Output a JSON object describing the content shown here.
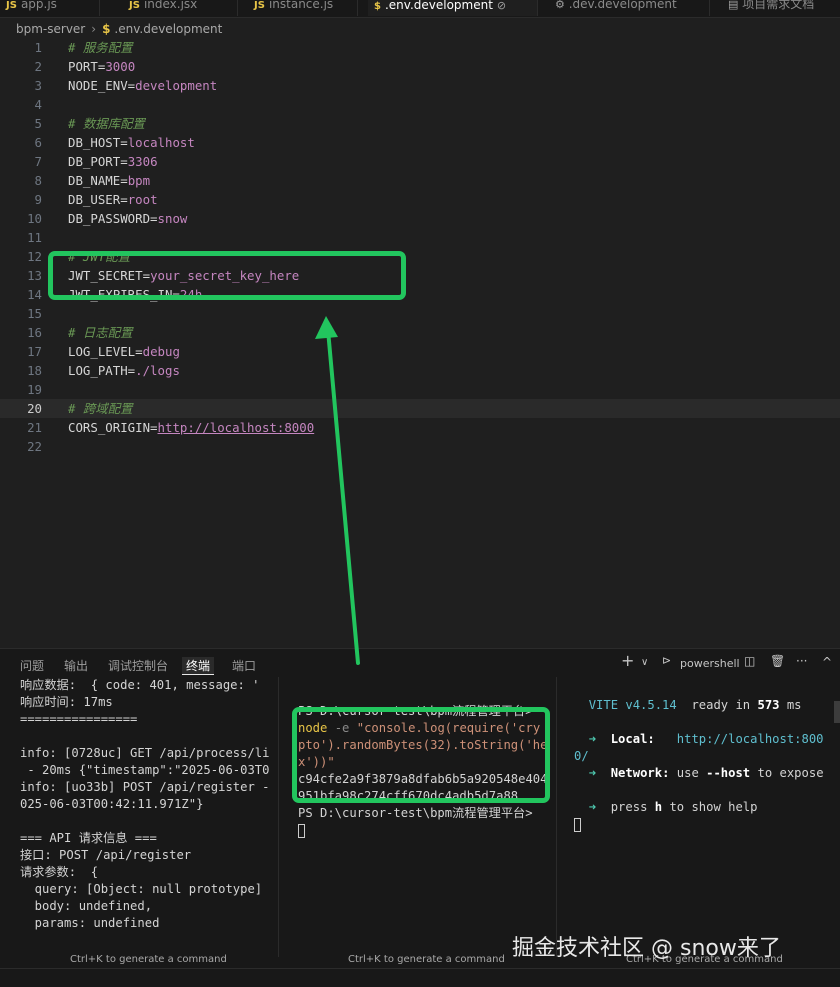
{
  "tabs": [
    {
      "label": "app.js",
      "icon": "js-icon"
    },
    {
      "label": "index.jsx",
      "icon": "js-icon"
    },
    {
      "label": "instance.js",
      "icon": "js-icon"
    },
    {
      "label": ".env.development",
      "icon": "dollar-icon",
      "active": true
    },
    {
      "label": ".dev.development",
      "icon": "settings-file-icon"
    },
    {
      "label": "项目需求文档",
      "icon": "markdown-icon"
    }
  ],
  "breadcrumb": {
    "folder": "bpm-server",
    "file": ".env.development"
  },
  "editor": {
    "lines": [
      {
        "n": "1",
        "key": "",
        "val": "",
        "comment": "# 服务配置"
      },
      {
        "n": "2",
        "key": "PORT=",
        "val": "3000",
        "comment": ""
      },
      {
        "n": "3",
        "key": "NODE_ENV=",
        "val": "development",
        "comment": ""
      },
      {
        "n": "4",
        "key": "",
        "val": "",
        "comment": ""
      },
      {
        "n": "5",
        "key": "",
        "val": "",
        "comment": "# 数据库配置"
      },
      {
        "n": "6",
        "key": "DB_HOST=",
        "val": "localhost",
        "comment": ""
      },
      {
        "n": "7",
        "key": "DB_PORT=",
        "val": "3306",
        "comment": ""
      },
      {
        "n": "8",
        "key": "DB_NAME=",
        "val": "bpm",
        "comment": ""
      },
      {
        "n": "9",
        "key": "DB_USER=",
        "val": "root",
        "comment": ""
      },
      {
        "n": "10",
        "key": "DB_PASSWORD=",
        "val": "snow",
        "comment": ""
      },
      {
        "n": "11",
        "key": "",
        "val": "",
        "comment": ""
      },
      {
        "n": "12",
        "key": "",
        "val": "",
        "comment": "# JWT配置"
      },
      {
        "n": "13",
        "key": "JWT_SECRET=",
        "val": "your_secret_key_here",
        "comment": ""
      },
      {
        "n": "14",
        "key": "JWT_EXPIRES_IN=",
        "val": "24h",
        "comment": ""
      },
      {
        "n": "15",
        "key": "",
        "val": "",
        "comment": ""
      },
      {
        "n": "16",
        "key": "",
        "val": "",
        "comment": "# 日志配置"
      },
      {
        "n": "17",
        "key": "LOG_LEVEL=",
        "val": "debug",
        "comment": ""
      },
      {
        "n": "18",
        "key": "LOG_PATH=",
        "val": "./logs",
        "comment": ""
      },
      {
        "n": "19",
        "key": "",
        "val": "",
        "comment": ""
      },
      {
        "n": "20",
        "key": "",
        "val": "",
        "comment": "# 跨域配置",
        "current": true
      },
      {
        "n": "21",
        "key": "CORS_ORIGIN=",
        "val": "http://localhost:8000",
        "comment": "",
        "url": true
      },
      {
        "n": "22",
        "key": "",
        "val": "",
        "comment": ""
      }
    ]
  },
  "panel": {
    "tabs": [
      "问题",
      "输出",
      "调试控制台",
      "终端",
      "端口"
    ],
    "active_tab": "终端",
    "shell_label": "powershell",
    "actions": {
      "add": "+",
      "dropdown": "∨",
      "split": "split-icon",
      "trash": "trash-icon",
      "more": "···",
      "collapse": "^"
    }
  },
  "terminal1": {
    "lines": [
      "响应数据:  { code: 401, message: '",
      "响应时间: 17ms",
      "================",
      "",
      "info: [0728uc] GET /api/process/li",
      " - 20ms {\"timestamp\":\"2025-06-03T0",
      "info: [uo33b] POST /api/register -",
      "025-06-03T00:42:11.971Z\"}",
      "",
      "=== API 请求信息 ===",
      "接口: POST /api/register",
      "请求参数:  {",
      "  query: [Object: null prototype]",
      "  body: undefined,",
      "  params: undefined"
    ],
    "hint": "Ctrl+K to generate a command"
  },
  "terminal2": {
    "prompt1": "PS D:\\cursor-test\\bpm流程管理平台>",
    "cmd": "node",
    "opt": "-e",
    "str1": "\"console.log(require('cry",
    "str2": "pto').randomBytes(32).toString('he",
    "str3": "x'))\"",
    "out1": "c94cfe2a9f3879a8dfab6b5a920548e404",
    "out2": "951bfa98c274cff670dc4adb5d7a88",
    "prompt2": "PS D:\\cursor-test\\bpm流程管理平台>",
    "hint": "Ctrl+K to generate a command"
  },
  "terminal3": {
    "vite_name": "VITE v4.5.14",
    "ready_text": "ready in",
    "ready_ms": "573",
    "ms_unit": "ms",
    "local_label": "Local:",
    "local_url": "http://localhost:800",
    "local_url2": "0/",
    "network_label": "Network:",
    "network_text1": "use",
    "network_flag": "--host",
    "network_text2": "to expose",
    "help_text1": "press",
    "help_key": "h",
    "help_text2": "to show help",
    "hint": "Ctrl+K to generate a command"
  },
  "watermark": "掘金技术社区 @ snow来了",
  "colors": {
    "highlight": "#22c55e",
    "value": "#c586c0",
    "comment": "#6a9955",
    "link": "#5fbfcf"
  }
}
